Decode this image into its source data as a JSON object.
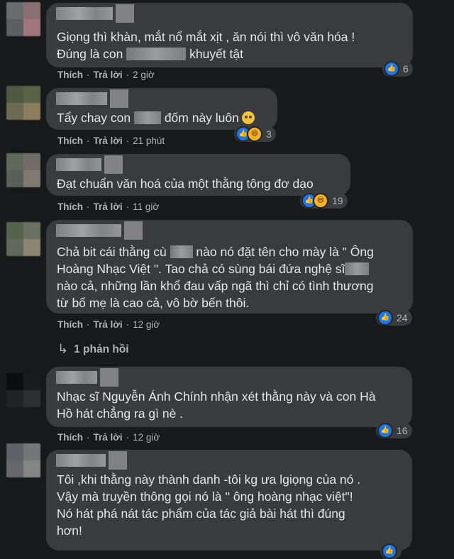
{
  "action_labels": {
    "like": "Thích",
    "reply": "Trả lời",
    "separator": "·"
  },
  "comments": [
    {
      "text_a": "Giọng thì khàn, mắt nổ mắt xịt , ăn nói thì vô văn hóa !\nĐúng là con ",
      "text_b": " khuyết tật",
      "time": "2 giờ",
      "reactions": [
        "like"
      ],
      "reaction_count": "6"
    },
    {
      "text_a": "Tẩy chay con ",
      "text_b": " đốm này luôn",
      "time": "21 phút",
      "reactions": [
        "like",
        "haha"
      ],
      "reaction_count": "3"
    },
    {
      "text_a": "Đạt chuẩn văn hoá của một thằng tông đơ dạo",
      "time": "11 giờ",
      "reactions": [
        "like",
        "haha"
      ],
      "reaction_count": "19"
    },
    {
      "text_a": "Chả bit cái thằng cù ",
      "text_b": " nào nó đặt tên cho mày là \" Ông\nHoàng Nhạc Việt \". Tao chả có sùng bái đứa nghệ sĩ",
      "text_c": "\nnào cả, những lần khổ đau vấp ngã thì chỉ có tình thương\ntừ bố mẹ là cao cả, vô bờ bến thôi.",
      "time": "12 giờ",
      "reactions": [
        "like"
      ],
      "reaction_count": "24",
      "replies_label": "1 phản hồi"
    },
    {
      "text_a": "Nhạc sĩ Nguyễn Ánh Chính nhận xét thằng này và con Hà\nHồ hát chẳng ra gì nè .",
      "time": "12 giờ",
      "reactions": [
        "like"
      ],
      "reaction_count": "16"
    },
    {
      "text_a": "Tôi ,khi thằng này thành danh -tôi kg ưa lgiọng của nó .\nVậy mà truyền thông gọi nó là '' ông hoàng nhạc việt\"!\nNó hát phá nát tác phẩm của tác giả bài hát thì đúng\nhơn!"
    }
  ],
  "icons": {
    "like": "thumbs-up-icon",
    "haha": "laughing-face-icon",
    "emoji": "flushed-face-icon",
    "reply_arrow": "reply-arrow-icon"
  },
  "colors": {
    "background": "#18191a",
    "bubble": "#3a3b3c",
    "like_blue": "#1877f2",
    "emoji_yellow": "#f7b125"
  }
}
